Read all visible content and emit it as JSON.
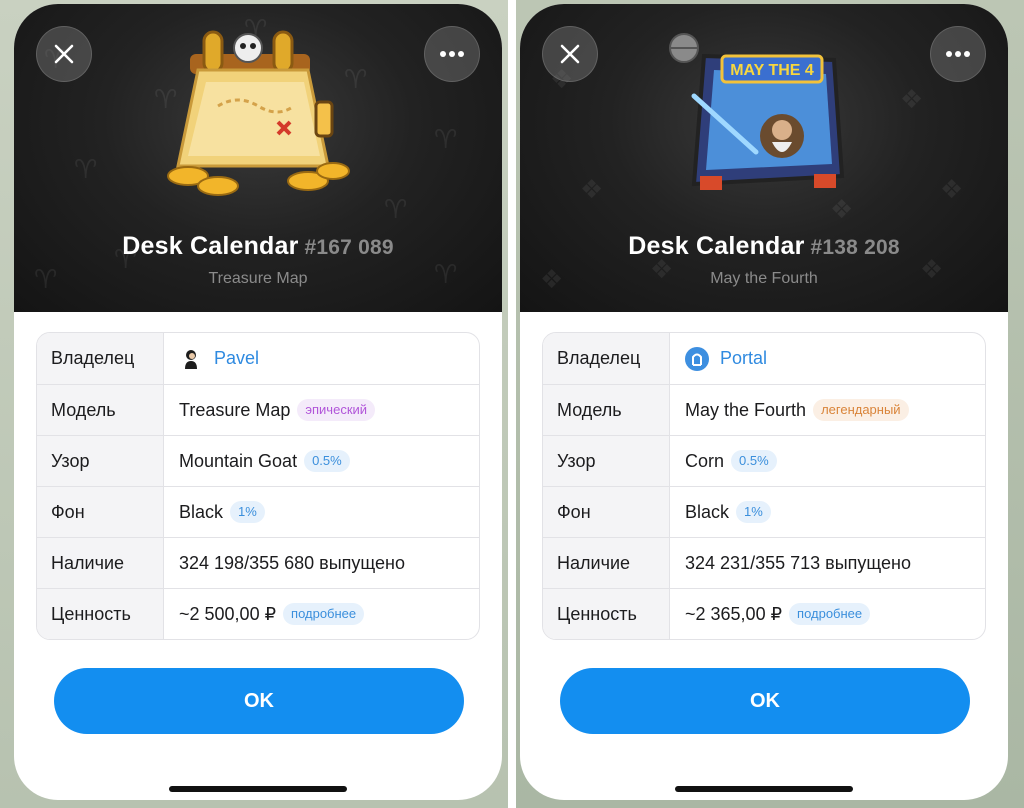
{
  "colors": {
    "accent": "#138ef0",
    "link": "#2f8ae0",
    "hero_bg": "#1e1e1e"
  },
  "left_card": {
    "close_icon": "close-icon",
    "more_icon": "more-horizontal-icon",
    "gift_icon": "treasure-map-calendar-icon",
    "title": "Desk Calendar",
    "number": "#167 089",
    "subtitle": "Treasure Map",
    "rows": {
      "owner": {
        "label": "Владелец",
        "value": "Pavel",
        "icon": "user-avatar-icon"
      },
      "model": {
        "label": "Модель",
        "value": "Treasure Map",
        "badge": "эпический"
      },
      "pattern": {
        "label": "Узор",
        "value": "Mountain Goat",
        "badge": "0.5%"
      },
      "backdrop": {
        "label": "Фон",
        "value": "Black",
        "badge": "1%"
      },
      "availability": {
        "label": "Наличие",
        "value": "324 198/355 680 выпущено"
      },
      "value": {
        "label": "Ценность",
        "value": "~2 500,00 ₽",
        "badge": "подробнее"
      }
    },
    "ok_label": "OK"
  },
  "right_card": {
    "close_icon": "close-icon",
    "more_icon": "more-horizontal-icon",
    "gift_icon": "may-the-fourth-calendar-icon",
    "title": "Desk Calendar",
    "number": "#138 208",
    "subtitle": "May the Fourth",
    "rows": {
      "owner": {
        "label": "Владелец",
        "value": "Portal",
        "icon": "portal-avatar-icon"
      },
      "model": {
        "label": "Модель",
        "value": "May the Fourth",
        "badge": "легендарный"
      },
      "pattern": {
        "label": "Узор",
        "value": "Corn",
        "badge": "0.5%"
      },
      "backdrop": {
        "label": "Фон",
        "value": "Black",
        "badge": "1%"
      },
      "availability": {
        "label": "Наличие",
        "value": "324 231/355 713 выпущено"
      },
      "value": {
        "label": "Ценность",
        "value": "~2 365,00 ₽",
        "badge": "подробнее"
      }
    },
    "ok_label": "OK"
  }
}
